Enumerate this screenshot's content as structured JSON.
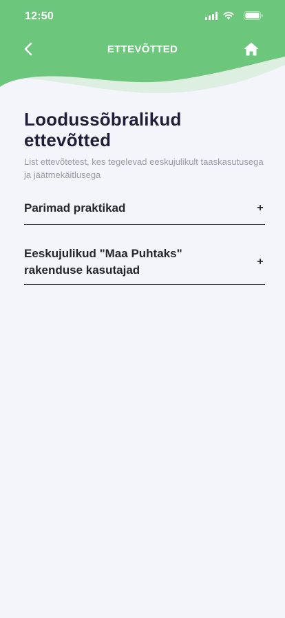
{
  "status_bar": {
    "time": "12:50",
    "icons": [
      "signal-icon",
      "wifi-icon",
      "battery-icon"
    ]
  },
  "nav": {
    "back_icon": "chevron-left-icon",
    "title": "ETTEVÕTTED",
    "home_icon": "home-icon"
  },
  "colors": {
    "header_green": "#6cc67b",
    "header_wave_light": "#dcefe0",
    "background": "#f4f5fa",
    "title_text": "#1f1d3a",
    "subtitle_text": "#9a9aa6"
  },
  "page": {
    "title": "Loodussõbralikud ettevõtted",
    "subtitle": "List ettevõtetest, kes tegelevad eeskujulikult taaskasutusega ja jäätmekäitlusega"
  },
  "accordion": [
    {
      "label": "Parimad praktikad",
      "toggle": "+"
    },
    {
      "label": "Eeskujulikud \"Maa Puhtaks\" rakenduse kasutajad",
      "toggle": "+"
    }
  ]
}
